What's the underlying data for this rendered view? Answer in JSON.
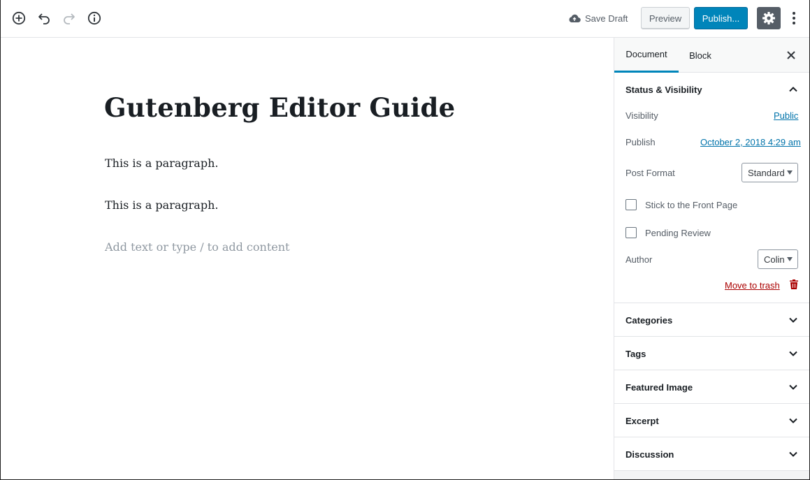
{
  "toolbar": {
    "save_draft_label": "Save Draft",
    "preview_label": "Preview",
    "publish_label": "Publish...",
    "icons": [
      "add-block-icon",
      "undo-icon",
      "redo-icon",
      "info-icon",
      "cloud-upload-icon",
      "gear-icon",
      "more-vertical-icon"
    ],
    "accent_color": "#0085ba"
  },
  "editor": {
    "title": "Gutenberg Editor Guide",
    "paragraphs": [
      "This is a paragraph.",
      "This is a paragraph."
    ],
    "placeholder": "Add text or type / to add content"
  },
  "sidebar": {
    "tabs": [
      {
        "label": "Document",
        "active": true
      },
      {
        "label": "Block",
        "active": false
      }
    ],
    "status_visibility": {
      "title": "Status & Visibility",
      "expanded": true,
      "visibility_label": "Visibility",
      "visibility_value": "Public",
      "publish_label": "Publish",
      "publish_value": "October 2, 2018 4:29 am",
      "post_format_label": "Post Format",
      "post_format_value": "Standard",
      "stick_label": "Stick to the Front Page",
      "stick_checked": false,
      "pending_label": "Pending Review",
      "pending_checked": false,
      "author_label": "Author",
      "author_value": "Colin",
      "trash_label": "Move to trash",
      "trash_color": "#a00"
    },
    "panels": [
      {
        "title": "Categories",
        "expanded": false
      },
      {
        "title": "Tags",
        "expanded": false
      },
      {
        "title": "Featured Image",
        "expanded": false
      },
      {
        "title": "Excerpt",
        "expanded": false
      },
      {
        "title": "Discussion",
        "expanded": false
      }
    ]
  }
}
